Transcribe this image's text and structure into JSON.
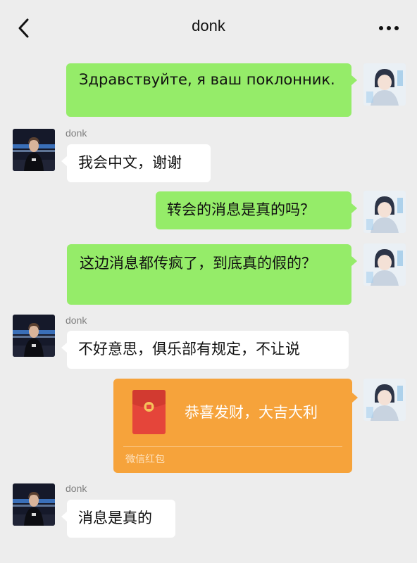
{
  "header": {
    "title": "donk",
    "back_icon": "chevron-left-icon",
    "more_icon": "more-horizontal-icon"
  },
  "messages": [
    {
      "from": "me",
      "text": "Здравствуйте, я ваш поклонник."
    },
    {
      "from": "donk",
      "sender": "donk",
      "text": "我会中文，谢谢"
    },
    {
      "from": "me",
      "text": "转会的消息是真的吗？"
    },
    {
      "from": "me",
      "text": "这边消息都传疯了，到底真的假的？"
    },
    {
      "from": "donk",
      "sender": "donk",
      "text": "不好意思，俱乐部有规定，不让说"
    },
    {
      "from": "me",
      "type": "red-packet",
      "text": "恭喜发财，大吉大利",
      "source": "微信红包"
    },
    {
      "from": "donk",
      "sender": "donk",
      "text": "消息是真的"
    }
  ],
  "colors": {
    "background": "#ededed",
    "my_bubble": "#95ec69",
    "their_bubble": "#ffffff",
    "red_packet": "#f6a33b",
    "red_packet_icon": "#e5453a"
  }
}
